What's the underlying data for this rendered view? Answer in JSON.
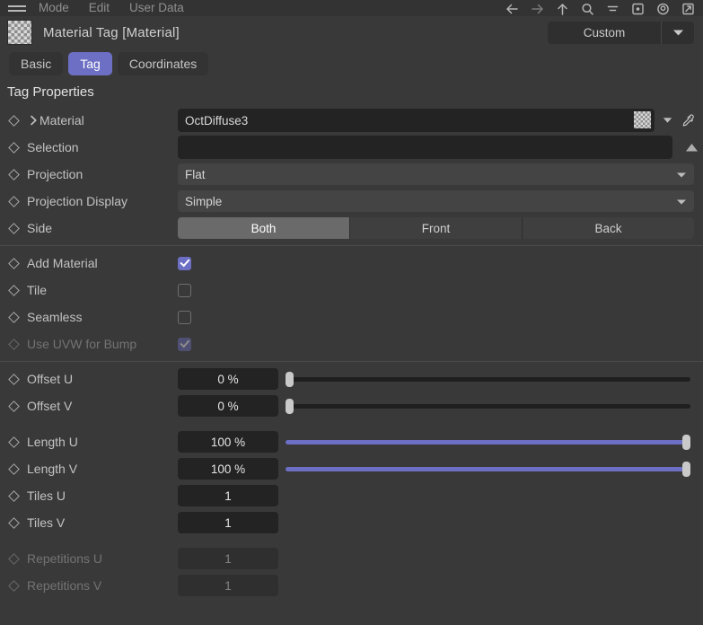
{
  "menubar": {
    "icon": "hamburger-icon",
    "items": [
      "Mode",
      "Edit",
      "User Data"
    ],
    "toolbar_icons": [
      "back-arrow-icon",
      "forward-arrow-icon",
      "up-arrow-icon",
      "search-icon",
      "filter-icon",
      "square-dot-icon",
      "target-circle-icon",
      "open-external-icon"
    ]
  },
  "titlebar": {
    "thumbnail": "checkerboard-material-icon",
    "title": "Material Tag [Material]",
    "layout_dropdown": {
      "value": "Custom",
      "icon": "chevron-down-icon"
    }
  },
  "tabs": [
    {
      "label": "Basic",
      "active": false
    },
    {
      "label": "Tag",
      "active": true
    },
    {
      "label": "Coordinates",
      "active": false
    }
  ],
  "section": {
    "title": "Tag Properties"
  },
  "properties": {
    "material": {
      "label": "Material",
      "expand_icon": "chevron-right-icon",
      "value": "OctDiffuse3",
      "swatch_icon": "checkerboard-swatch-icon",
      "dropdown_icon": "chevron-down-icon",
      "picker_icon": "eyedropper-icon"
    },
    "selection": {
      "label": "Selection",
      "value": "",
      "placeholder": "",
      "button_icon": "triangle-up-icon"
    },
    "projection": {
      "label": "Projection",
      "value": "Flat",
      "icon": "chevron-down-icon"
    },
    "projection_display": {
      "label": "Projection Display",
      "value": "Simple",
      "icon": "chevron-down-icon"
    },
    "side": {
      "label": "Side",
      "options": [
        "Both",
        "Front",
        "Back"
      ],
      "selected": "Both"
    },
    "add_material": {
      "label": "Add Material",
      "checked": true,
      "disabled": false
    },
    "tile": {
      "label": "Tile",
      "checked": false,
      "disabled": false
    },
    "seamless": {
      "label": "Seamless",
      "checked": false,
      "disabled": false
    },
    "use_uvw_for_bump": {
      "label": "Use UVW for Bump",
      "checked": true,
      "disabled": true
    },
    "offset_u": {
      "label": "Offset U",
      "value": "0 %",
      "percent": 0
    },
    "offset_v": {
      "label": "Offset V",
      "value": "0 %",
      "percent": 0
    },
    "length_u": {
      "label": "Length U",
      "value": "100 %",
      "percent": 100
    },
    "length_v": {
      "label": "Length V",
      "value": "100 %",
      "percent": 100
    },
    "tiles_u": {
      "label": "Tiles U",
      "value": "1"
    },
    "tiles_v": {
      "label": "Tiles V",
      "value": "1"
    },
    "repetitions_u": {
      "label": "Repetitions U",
      "value": "1",
      "disabled": true
    },
    "repetitions_v": {
      "label": "Repetitions V",
      "value": "1",
      "disabled": true
    }
  },
  "colors": {
    "accent": "#6c6fc4",
    "background": "#393939",
    "field": "#232323",
    "field_light": "#444444",
    "text": "#c8c8c8"
  }
}
